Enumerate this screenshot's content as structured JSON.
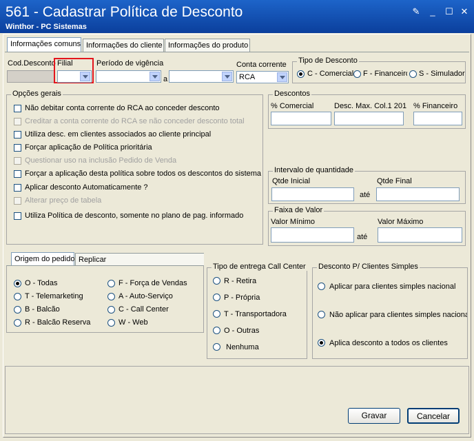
{
  "window": {
    "title": "561 - Cadastrar Política de Desconto",
    "subtitle": "Winthor - PC Sistemas"
  },
  "tabs": [
    "Informações comuns",
    "Informações do cliente",
    "Informações do produto"
  ],
  "header": {
    "cod_desconto_label": "Cod.Desconto",
    "filial_label": "Filial",
    "periodo_label": "Período de vigência",
    "periodo_sep": "a",
    "conta_corrente_label": "Conta corrente",
    "conta_corrente_value": "RCA"
  },
  "tipo_desconto": {
    "title": "Tipo de Desconto",
    "options": [
      "C - Comercial",
      "F - Financeiro",
      "S - Simulador"
    ],
    "selected": 0
  },
  "opcoes_gerais": {
    "title": "Opções gerais",
    "items": [
      {
        "label": "Não debitar conta corrente do RCA ao conceder desconto",
        "enabled": true
      },
      {
        "label": "Creditar a conta corrente do RCA se não conceder desconto total",
        "enabled": false
      },
      {
        "label": "Utiliza desc. em clientes associados ao cliente principal",
        "enabled": true
      },
      {
        "label": "Forçar aplicação de Política prioritária",
        "enabled": true
      },
      {
        "label": "Questionar uso na inclusão Pedido de Venda",
        "enabled": false
      },
      {
        "label": "Forçar a aplicação desta política sobre todos os descontos do sistema",
        "enabled": true
      },
      {
        "label": "Aplicar desconto Automaticamente ?",
        "enabled": true
      },
      {
        "label": "Alterar preço de tabela",
        "enabled": false
      },
      {
        "label": "Utiliza Política de desconto, somente no plano de pag. informado",
        "enabled": true
      }
    ]
  },
  "descontos": {
    "title": "Descontos",
    "cols": [
      "% Comercial",
      "Desc. Max. Col.1 201",
      "% Financeiro"
    ]
  },
  "intervalo": {
    "title": "Intervalo de quantidade",
    "inicial": "Qtde Inicial",
    "final": "Qtde Final",
    "sep": "até"
  },
  "faixa": {
    "title": "Faixa de Valor",
    "minimo": "Valor Mínimo",
    "maximo": "Valor Máximo",
    "sep": "até"
  },
  "subtabs": [
    "Origem do pedido",
    "Replicar"
  ],
  "origem": {
    "col1": [
      "O - Todas",
      "T - Telemarketing",
      "B - Balcão",
      "R - Balcão Reserva"
    ],
    "col2": [
      "F - Força de Vendas",
      "A - Auto-Serviço",
      "C - Call Center",
      "W - Web"
    ],
    "selected": "O - Todas"
  },
  "entrega": {
    "title": "Tipo de entrega Call Center",
    "options": [
      "R - Retira",
      "P - Própria",
      "T - Transportadora",
      "O - Outras",
      "Nenhuma"
    ]
  },
  "simples": {
    "title": "Desconto P/ Clientes Simples",
    "options": [
      "Aplicar para clientes simples nacional",
      "Não aplicar para clientes simples nacional",
      "Aplica desconto a todos os clientes"
    ],
    "selected": 2
  },
  "buttons": {
    "gravar": "Gravar",
    "cancelar": "Cancelar"
  }
}
